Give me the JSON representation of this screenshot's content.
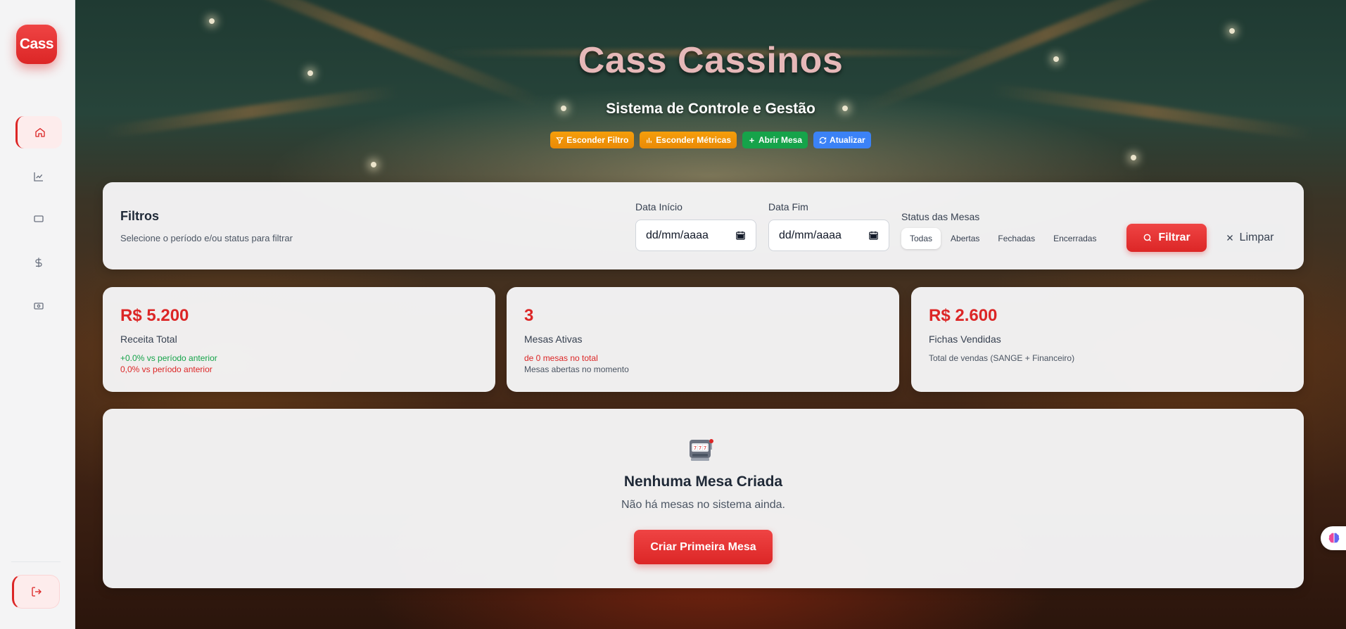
{
  "app": {
    "logo_text": "Cass",
    "title": "Cass Cassinos",
    "subtitle": "Sistema de Controle e Gestão",
    "accent_color": "#dc2626"
  },
  "sidebar": {
    "items": [
      {
        "icon": "home-icon",
        "active": true
      },
      {
        "icon": "chart-icon",
        "active": false
      },
      {
        "icon": "card-icon",
        "active": false
      },
      {
        "icon": "dollar-icon",
        "active": false
      },
      {
        "icon": "cash-icon",
        "active": false
      }
    ],
    "logout_icon": "logout-icon"
  },
  "actions": [
    {
      "label": "Esconder Filtro",
      "icon": "filter-icon",
      "color": "#f59e0b"
    },
    {
      "label": "Esconder Métricas",
      "icon": "bar-chart-icon",
      "color": "#f59e0b"
    },
    {
      "label": "Abrir Mesa",
      "icon": "plus-icon",
      "color": "#16a34a"
    },
    {
      "label": "Atualizar",
      "icon": "refresh-icon",
      "color": "#3b82f6"
    }
  ],
  "filters": {
    "title": "Filtros",
    "subtitle": "Selecione o período e/ou status para filtrar",
    "start_label": "Data Início",
    "start_placeholder": "dd/mm/aaaa",
    "end_label": "Data Fim",
    "end_placeholder": "dd/mm/aaaa",
    "status_label": "Status das Mesas",
    "status_options": [
      "Todas",
      "Abertas",
      "Fechadas",
      "Encerradas"
    ],
    "status_selected": "Todas",
    "filter_button": "Filtrar",
    "clear_button": "Limpar"
  },
  "metrics": [
    {
      "value": "R$ 5.200",
      "label": "Receita Total",
      "line1": "+0.0% vs período anterior",
      "line2": "0,0% vs período anterior"
    },
    {
      "value": "3",
      "label": "Mesas Ativas",
      "line1": "de 0 mesas no total",
      "line2": "Mesas abertas no momento"
    },
    {
      "value": "R$ 2.600",
      "label": "Fichas Vendidas",
      "line1": "Total de vendas (SANGE + Financeiro)"
    }
  ],
  "empty_state": {
    "icon": "slot-machine-icon",
    "title": "Nenhuma Mesa Criada",
    "message": "Não há mesas no sistema ainda.",
    "button": "Criar Primeira Mesa"
  },
  "floating": {
    "icon": "brain-icon"
  }
}
